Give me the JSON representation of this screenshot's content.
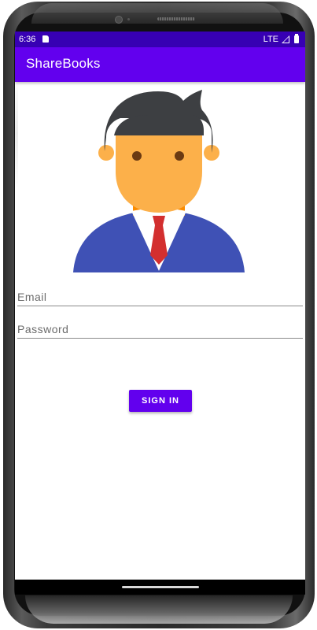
{
  "status_bar": {
    "time": "6:36",
    "network": "LTE",
    "sd_card_icon": "sd-card-icon",
    "signal_icon": "signal-icon",
    "battery_icon": "battery-icon"
  },
  "app_bar": {
    "title": "ShareBooks"
  },
  "avatar": {
    "icon": "businessman-avatar-icon",
    "colors": {
      "hair": "#3d3f42",
      "skin": "#fcb04a",
      "neck": "#fb8c00",
      "suit": "#3f51b5",
      "shirt": "#ffffff",
      "tie": "#d32f2f"
    }
  },
  "form": {
    "email_placeholder": "Email",
    "email_value": "",
    "password_placeholder": "Password",
    "password_value": ""
  },
  "sign_in": {
    "label": "SIGN IN"
  },
  "theme": {
    "primary": "#6200ee",
    "primary_dark": "#3700b3",
    "on_primary": "#ffffff"
  }
}
